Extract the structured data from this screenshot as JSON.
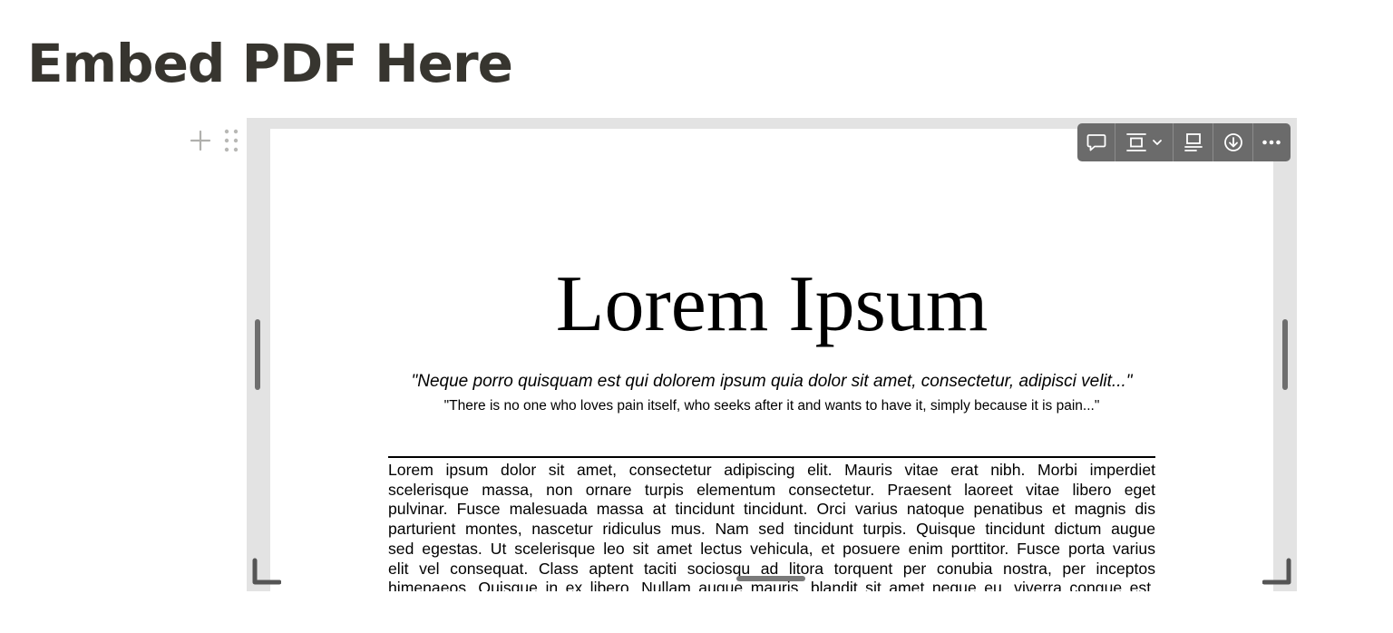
{
  "page": {
    "title": "Embed PDF Here"
  },
  "block": {
    "add_icon": "plus-icon",
    "drag_icon": "drag-handle-icon"
  },
  "toolbar": {
    "buttons": [
      {
        "icon": "comment-icon"
      },
      {
        "icon": "align-icon"
      },
      {
        "icon": "caption-icon"
      },
      {
        "icon": "download-icon"
      },
      {
        "icon": "more-icon"
      }
    ]
  },
  "pdf": {
    "title": "Lorem Ipsum",
    "quote": "\"Neque porro quisquam est qui dolorem ipsum quia dolor sit amet, consectetur, adipisci velit...\"",
    "subquote": "\"There is no one who loves pain itself, who seeks after it and wants to have it, simply because it is pain...\"",
    "body_lines": [
      "Lorem ipsum dolor sit amet, consectetur adipiscing elit. Mauris vitae erat nibh. Morbi imperdiet",
      "scelerisque massa, non ornare turpis elementum consectetur. Praesent laoreet vitae libero eget",
      "pulvinar. Fusce malesuada massa at tincidunt tincidunt. Orci varius natoque penatibus et magnis dis",
      "parturient montes, nascetur ridiculus mus. Nam sed tincidunt turpis. Quisque tincidunt dictum augue",
      "sed egestas. Ut scelerisque leo sit amet lectus vehicula, et posuere enim porttitor. Fusce porta varius",
      "elit vel consequat. Class aptent taciti sociosqu ad litora torquent per conubia nostra, per inceptos",
      "himenaeos. Quisque in ex libero. Nullam augue mauris, blandit sit amet neque eu, viverra congue est."
    ]
  },
  "colors": {
    "title_text": "#37352f",
    "frame_bg": "#e3e3e3",
    "toolbar_bg": "#6b6b6b"
  }
}
